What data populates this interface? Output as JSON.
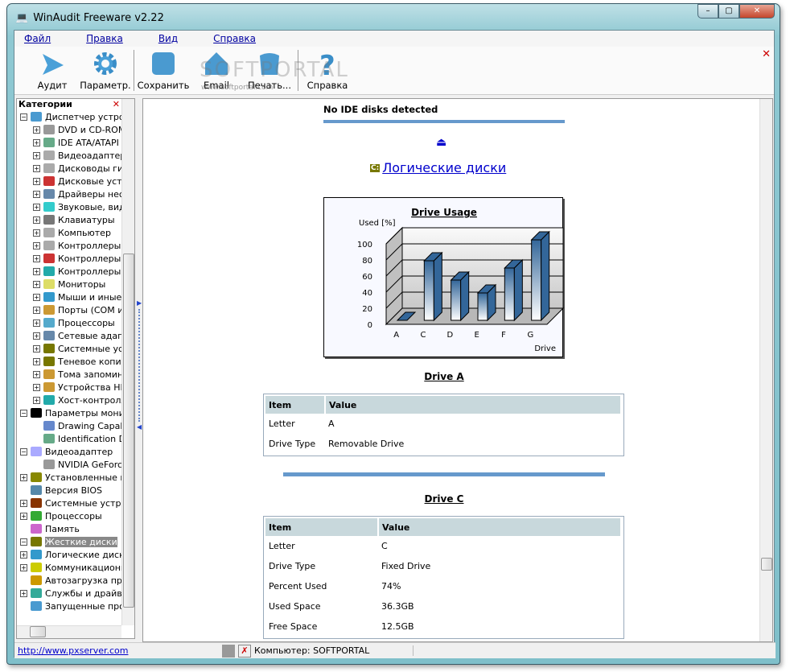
{
  "window": {
    "title": "WinAudit Freeware v2.22"
  },
  "menu": [
    "Файл",
    "Правка",
    "Вид",
    "Справка"
  ],
  "toolbar": [
    {
      "label": "Аудит",
      "icon": "play-icon"
    },
    {
      "label": "Параметр.",
      "icon": "gear-icon"
    },
    {
      "label": "Сохранить",
      "icon": "save-icon"
    },
    {
      "label": "Email",
      "icon": "email-icon"
    },
    {
      "label": "Печать...",
      "icon": "print-icon"
    },
    {
      "label": "Справка",
      "icon": "help-icon"
    }
  ],
  "watermark": {
    "text": "SOFTPORTAL",
    "url": "www.softportal.com"
  },
  "sidebar": {
    "title": "Категории",
    "items": [
      {
        "label": "Диспетчер устройств",
        "level": 0,
        "exp": "-"
      },
      {
        "label": "DVD и CD-ROM",
        "level": 1,
        "exp": "+"
      },
      {
        "label": "IDE ATA/ATAPI",
        "level": 1,
        "exp": "+"
      },
      {
        "label": "Видеоадаптеры",
        "level": 1,
        "exp": "+"
      },
      {
        "label": "Дисководы гибких",
        "level": 1,
        "exp": "+"
      },
      {
        "label": "Дисковые устройства",
        "level": 1,
        "exp": "+"
      },
      {
        "label": "Драйверы несамонастр",
        "level": 1,
        "exp": "+"
      },
      {
        "label": "Звуковые, видео",
        "level": 1,
        "exp": "+"
      },
      {
        "label": "Клавиатуры",
        "level": 1,
        "exp": "+"
      },
      {
        "label": "Компьютер",
        "level": 1,
        "exp": "+"
      },
      {
        "label": "Контроллеры IDE",
        "level": 1,
        "exp": "+"
      },
      {
        "label": "Контроллеры запоминающих",
        "level": 1,
        "exp": "+"
      },
      {
        "label": "Контроллеры универсальной",
        "level": 1,
        "exp": "+"
      },
      {
        "label": "Мониторы",
        "level": 1,
        "exp": "+"
      },
      {
        "label": "Мыши и иные указывающие",
        "level": 1,
        "exp": "+"
      },
      {
        "label": "Порты (COM и LPT)",
        "level": 1,
        "exp": "+"
      },
      {
        "label": "Процессоры",
        "level": 1,
        "exp": "+"
      },
      {
        "label": "Сетевые адаптеры",
        "level": 1,
        "exp": "+"
      },
      {
        "label": "Системные устройства",
        "level": 1,
        "exp": "+"
      },
      {
        "label": "Теневое копирование",
        "level": 1,
        "exp": "+"
      },
      {
        "label": "Тома запоминающих",
        "level": 1,
        "exp": "+"
      },
      {
        "label": "Устройства HID",
        "level": 1,
        "exp": "+"
      },
      {
        "label": "Хост-контроллеры",
        "level": 1,
        "exp": "+"
      },
      {
        "label": "Параметры мониторов",
        "level": 0,
        "exp": "-"
      },
      {
        "label": "Drawing Capabilities",
        "level": 1,
        "exp": ""
      },
      {
        "label": "Identification Data",
        "level": 1,
        "exp": ""
      },
      {
        "label": "Видеоадаптер",
        "level": 0,
        "exp": "-"
      },
      {
        "label": "NVIDIA GeForce",
        "level": 1,
        "exp": ""
      },
      {
        "label": "Установленные программы",
        "level": 0,
        "exp": "+"
      },
      {
        "label": "Версия BIOS",
        "level": 0,
        "exp": ""
      },
      {
        "label": "Системные устройства",
        "level": 0,
        "exp": "+"
      },
      {
        "label": "Процессоры",
        "level": 0,
        "exp": "+"
      },
      {
        "label": "Память",
        "level": 0,
        "exp": ""
      },
      {
        "label": "Жесткие диски",
        "level": 0,
        "exp": "-",
        "selected": true
      },
      {
        "label": "Логические диски",
        "level": 0,
        "exp": "+"
      },
      {
        "label": "Коммуникационные порты",
        "level": 0,
        "exp": "+"
      },
      {
        "label": "Автозагрузка программ",
        "level": 0,
        "exp": ""
      },
      {
        "label": "Службы и драйверы",
        "level": 0,
        "exp": "+"
      },
      {
        "label": "Запущенные программы",
        "level": 0,
        "exp": ""
      }
    ]
  },
  "content": {
    "no_ide": "No IDE disks detected",
    "section_badge": "C:",
    "section_link": "Логические диски",
    "driveA": {
      "title": "Drive A",
      "headers": [
        "Item",
        "Value"
      ],
      "rows": [
        [
          "Letter",
          "A"
        ],
        [
          "Drive Type",
          "Removable Drive"
        ]
      ]
    },
    "driveC": {
      "title": "Drive C",
      "headers": [
        "Item",
        "Value"
      ],
      "rows": [
        [
          "Letter",
          "C"
        ],
        [
          "Drive Type",
          "Fixed Drive"
        ],
        [
          "Percent Used",
          "74%"
        ],
        [
          "Used Space",
          "36.3GB"
        ],
        [
          "Free Space",
          "12.5GB"
        ]
      ]
    }
  },
  "chart_data": {
    "type": "bar",
    "title": "Drive Usage",
    "ylabel": "Used [%]",
    "xlabel": "Drive",
    "categories": [
      "A",
      "C",
      "D",
      "E",
      "F",
      "G"
    ],
    "values": [
      0,
      74,
      50,
      34,
      65,
      100
    ],
    "ylim": [
      0,
      100
    ],
    "yticks": [
      0,
      20,
      40,
      60,
      80,
      100
    ],
    "grid": true
  },
  "status": {
    "link": "http://www.pxserver.com",
    "computer": "Компьютер: SOFTPORTAL"
  },
  "colors": {
    "bar": "#336699",
    "rule": "#6699cc",
    "header": "#c8d8dc"
  }
}
